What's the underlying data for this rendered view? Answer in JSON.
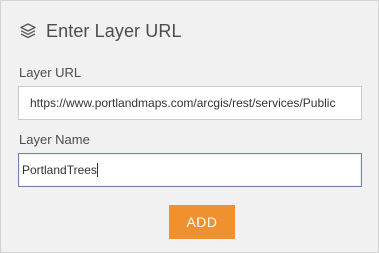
{
  "dialog": {
    "title": "Enter Layer URL",
    "title_icon": "layers-icon"
  },
  "layer_url": {
    "label": "Layer URL",
    "value": "https://www.portlandmaps.com/arcgis/rest/services/Public"
  },
  "layer_name": {
    "label": "Layer Name",
    "value": "PortlandTrees"
  },
  "actions": {
    "add_label": "ADD",
    "add_color": "#f0912f"
  }
}
